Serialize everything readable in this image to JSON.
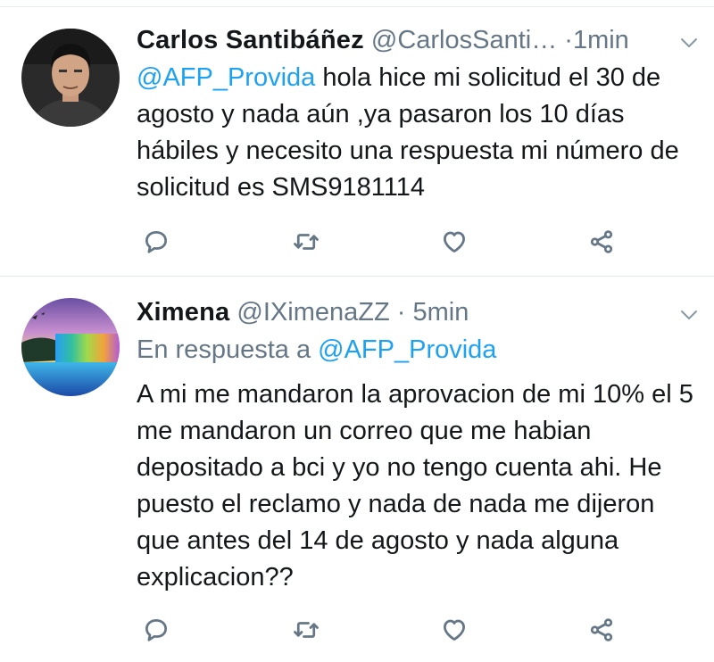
{
  "tweets": [
    {
      "name": "Carlos Santibáñez",
      "handle": "@CarlosSanti…",
      "separator": "·",
      "time": "1min",
      "mention": "@AFP_Provida",
      "text": " hola hice mi solicitud el 30 de agosto y nada aún ,ya pasaron los 10 días hábiles y necesito una respuesta mi número de solicitud es SMS9181114",
      "avatar_icon": "profile-photo",
      "actions": [
        "reply-icon",
        "retweet-icon",
        "like-icon",
        "share-icon"
      ]
    },
    {
      "name": "Ximena",
      "handle": "@IXimenaZZ",
      "separator": "·",
      "time": "5min",
      "reply_prefix": "En respuesta a ",
      "reply_mention": "@AFP_Provida",
      "text": "A mi me mandaron la aprovacion de mi 10% el 5 me mandaron un correo que me habian depositado a bci y yo no tengo cuenta ahi. He puesto el reclamo y nada de nada me dijeron que antes del 14 de agosto y nada alguna explicacion??",
      "avatar_icon": "waterfall-landscape-photo",
      "actions": [
        "reply-icon",
        "retweet-icon",
        "like-icon",
        "share-icon"
      ]
    }
  ],
  "colors": {
    "link": "#1da1f2",
    "secondary_text": "#657786",
    "primary_text": "#14171a",
    "divider": "#e1e8ed"
  }
}
